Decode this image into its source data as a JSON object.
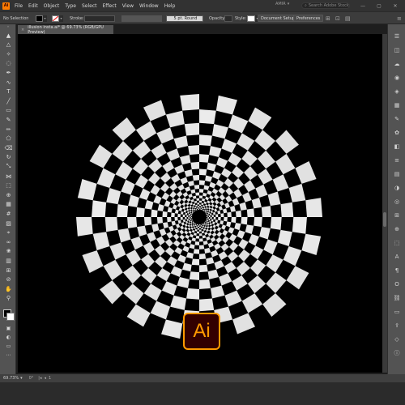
{
  "app": {
    "logo_text": "Ai",
    "accent": "#ff7c00",
    "logo_border": "#ff9a00",
    "logo_bg": "#330000"
  },
  "menu": [
    "File",
    "Edit",
    "Object",
    "Type",
    "Select",
    "Effect",
    "View",
    "Window",
    "Help"
  ],
  "header": {
    "workspace": "AMIR",
    "search_placeholder": "Search Adobe Stock"
  },
  "control_bar": {
    "selection_label": "No Selection",
    "stroke_label": "Stroke:",
    "stroke_profile": "5 pt. Round",
    "opacity_label": "Opacity:",
    "style_label": "Style:",
    "document_setup": "Document Setup",
    "preferences": "Preferences"
  },
  "document_tab": {
    "close": "×",
    "title": "illusion insta.ai* @ 69.73% (RGB/GPU Preview)"
  },
  "status": {
    "zoom": "69.73%"
  },
  "tools": [
    "selection-tool",
    "direct-selection-tool",
    "magic-wand-tool",
    "lasso-tool",
    "pen-tool",
    "curvature-tool",
    "type-tool",
    "line-tool",
    "rectangle-tool",
    "paintbrush-tool",
    "pencil-tool",
    "shaper-tool",
    "eraser-tool",
    "rotate-tool",
    "scale-tool",
    "width-tool",
    "free-transform-tool",
    "shape-builder-tool",
    "perspective-grid-tool",
    "mesh-tool",
    "gradient-tool",
    "eyedropper-tool",
    "blend-tool",
    "symbol-sprayer-tool",
    "column-graph-tool",
    "artboard-tool",
    "slice-tool",
    "hand-tool",
    "zoom-tool"
  ],
  "artwork": {
    "background": "#000000",
    "fill": "#ffffff"
  }
}
